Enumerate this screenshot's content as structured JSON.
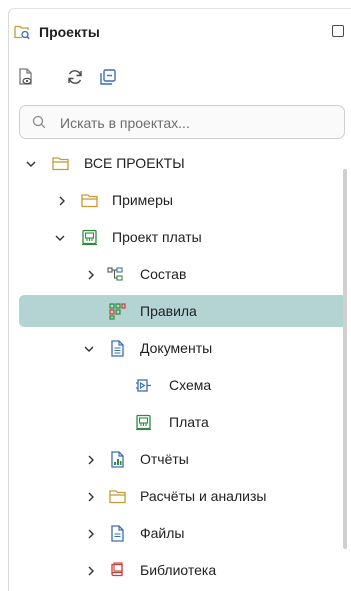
{
  "panel": {
    "title": "Проекты",
    "title_icon": "project-explorer-icon",
    "maximize_icon": "maximize-icon"
  },
  "toolbar": {
    "buttons": [
      {
        "name": "view-file-icon"
      },
      {
        "name": "refresh-icon"
      },
      {
        "name": "collapse-all-icon"
      }
    ]
  },
  "search": {
    "placeholder": "Искать в проектах...",
    "value": ""
  },
  "tree": {
    "items": [
      {
        "label": "ВСЕ ПРОЕКТЫ",
        "icon": "folder-icon",
        "expanded": true
      },
      {
        "label": "Примеры",
        "icon": "folder-icon",
        "expanded": false
      },
      {
        "label": "Проект платы",
        "icon": "pcb-project-icon",
        "expanded": true
      },
      {
        "label": "Состав",
        "icon": "hierarchy-icon",
        "expanded": false
      },
      {
        "label": "Правила",
        "icon": "rules-icon",
        "selected": true
      },
      {
        "label": "Документы",
        "icon": "document-icon",
        "expanded": true
      },
      {
        "label": "Схема",
        "icon": "schematic-icon"
      },
      {
        "label": "Плата",
        "icon": "pcb-icon"
      },
      {
        "label": "Отчёты",
        "icon": "report-icon",
        "expanded": false
      },
      {
        "label": "Расчёты и анализы",
        "icon": "folder-icon",
        "expanded": false
      },
      {
        "label": "Файлы",
        "icon": "file-icon",
        "expanded": false
      },
      {
        "label": "Библиотека",
        "icon": "library-icon",
        "expanded": false
      }
    ]
  },
  "colors": {
    "selected_bg": "#b3d4d2",
    "folder": "#c79a3a",
    "green": "#2e8b3e",
    "blue": "#3a6fb0",
    "red": "#c9403a"
  }
}
